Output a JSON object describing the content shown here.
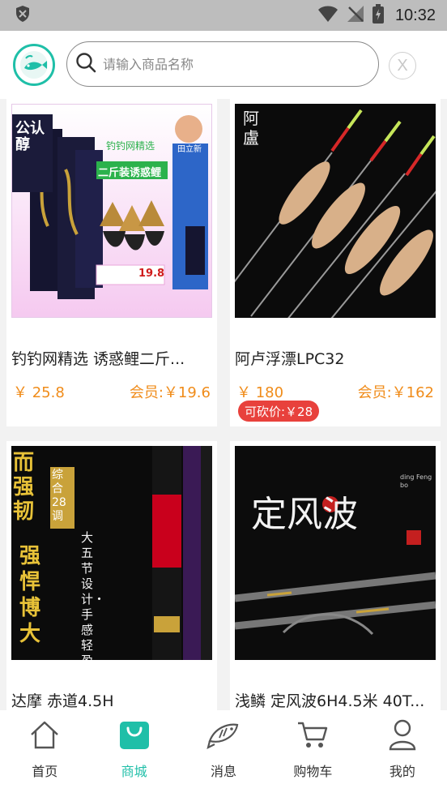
{
  "status_bar": {
    "time": "10:32"
  },
  "search": {
    "placeholder": "请输入商品名称",
    "close_label": "X"
  },
  "products": [
    {
      "title": "钓钓网精选 诱惑鲤二斤...",
      "price": "￥ 25.8",
      "member_price": "会员:￥19.6",
      "bargain": "",
      "image_text": {
        "tag": "钓钓网精选",
        "headline": "二斤装诱惑鲤",
        "left_badge": "公认醇",
        "price_tag": "19.8",
        "name_tag": "田立新"
      }
    },
    {
      "title": "阿卢浮漂LPC32",
      "price": "￥ 180",
      "member_price": "会员:￥162",
      "bargain": "可砍价:￥28",
      "image_text": {
        "brand": "阿盧"
      }
    },
    {
      "title": "达摩 赤道4.5H",
      "price": "",
      "member_price": "",
      "bargain": "",
      "image_text": {
        "line1": "而强韧",
        "line2": "强悍博大",
        "side": "综合28调",
        "side2": "大五节设计・手感轻盈"
      }
    },
    {
      "title": "浅鳞 定风波6H4.5米 40T...",
      "price": "",
      "member_price": "",
      "bargain": "",
      "image_text": {
        "headline": "定风波",
        "small": "ding Feng bo"
      }
    }
  ],
  "nav": [
    {
      "label": "首页",
      "icon": "home-icon",
      "active": false
    },
    {
      "label": "商城",
      "icon": "shopping-bag-icon",
      "active": true
    },
    {
      "label": "消息",
      "icon": "fish-icon",
      "active": false
    },
    {
      "label": "购物车",
      "icon": "cart-icon",
      "active": false
    },
    {
      "label": "我的",
      "icon": "user-icon",
      "active": false
    }
  ],
  "colors": {
    "accent": "#1fbfa8",
    "price": "#f08c1a",
    "bargain": "#e8413c"
  }
}
